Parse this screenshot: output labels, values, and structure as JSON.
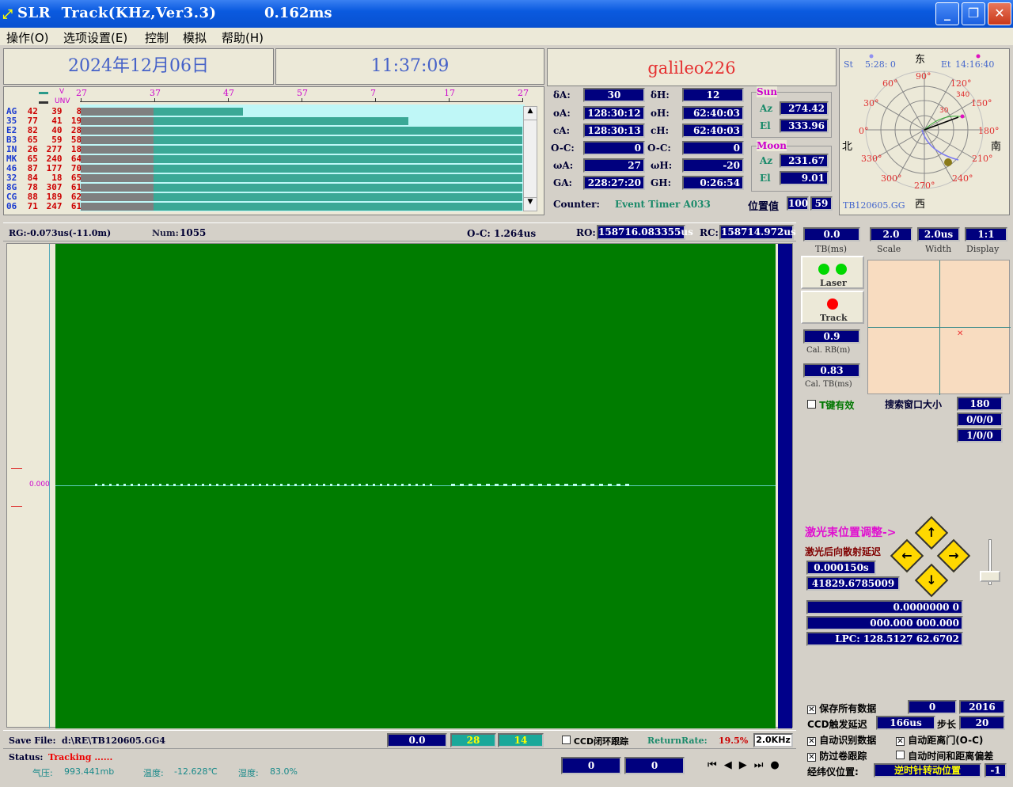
{
  "window": {
    "title": "SLR  Track(KHz,Ver3.3)",
    "timing": "0.162ms"
  },
  "menu": [
    "操作(O)",
    "选项设置(E)",
    "控制",
    "模拟",
    "帮助(H)"
  ],
  "header": {
    "date": "2024年12月06日",
    "time": "11:37:09",
    "satellite": "galileo226"
  },
  "sky_legend": {
    "v": "V",
    "unv": "UNV"
  },
  "sky_ticks": [
    "27",
    "37",
    "47",
    "57",
    "7",
    "17",
    "27"
  ],
  "sat_rows": [
    {
      "code": "AG",
      "a": "42",
      "b": "39",
      "c": "8",
      "fill": 0.367
    },
    {
      "code": "35",
      "a": "77",
      "b": "41",
      "c": "19",
      "fill": 0.742
    },
    {
      "code": "E2",
      "a": "82",
      "b": "40",
      "c": "28",
      "fill": 1
    },
    {
      "code": "B3",
      "a": "65",
      "b": "59",
      "c": "58",
      "fill": 1
    },
    {
      "code": "IN",
      "a": "26",
      "b": "277",
      "c": "18",
      "fill": 1
    },
    {
      "code": "MK",
      "a": "65",
      "b": "240",
      "c": "64",
      "fill": 1
    },
    {
      "code": "46",
      "a": "87",
      "b": "177",
      "c": "70",
      "fill": 1
    },
    {
      "code": "32",
      "a": "84",
      "b": "18",
      "c": "65",
      "fill": 1
    },
    {
      "code": "8G",
      "a": "78",
      "b": "307",
      "c": "61",
      "fill": 1
    },
    {
      "code": "CG",
      "a": "88",
      "b": "189",
      "c": "62",
      "fill": 1
    },
    {
      "code": "06",
      "a": "71",
      "b": "247",
      "c": "61",
      "fill": 1
    }
  ],
  "pos": {
    "dA_l": "δA:",
    "dA": "30",
    "dH_l": "δH:",
    "dH": "12",
    "oA_l": "oA:",
    "oA": "128:30:12",
    "oH_l": "oH:",
    "oH": "62:40:03",
    "cA_l": "cA:",
    "cA": "128:30:13",
    "cH_l": "cH:",
    "cH": "62:40:03",
    "ocA_l": "O-C:",
    "ocA": "0",
    "ocH_l": "O-C:",
    "ocH": "0",
    "wA_l": "ωA:",
    "wA": "27",
    "wH_l": "ωH:",
    "wH": "-20",
    "GA_l": "GA:",
    "GA": "228:27:20",
    "GH_l": "GH:",
    "GH": "0:26:54",
    "counter_l": "Counter:",
    "counter": "Event Timer A033",
    "posval_l": "位置值",
    "posval1": "100",
    "posval2": "59"
  },
  "sun": {
    "title": "Sun",
    "az_l": "Az",
    "az": "274.42",
    "el_l": "El",
    "el": "333.96"
  },
  "moon": {
    "title": "Moon",
    "az_l": "Az",
    "az": "231.67",
    "el_l": "El",
    "el": "9.01"
  },
  "polar": {
    "st": "St",
    "st_time": "5:28: 0",
    "et": "Et",
    "et_time": "14:16:40",
    "east": "东",
    "west": "西",
    "north": "北",
    "south": "南",
    "file": "TB120605.GG",
    "labels": [
      "90°",
      "120°",
      "150°",
      "180°",
      "210°",
      "240°",
      "270°",
      "300°",
      "330°",
      "0°",
      "30°",
      "60°",
      "340",
      "30"
    ]
  },
  "track": {
    "rg": "RG:-0.073us(-11.0m)",
    "num_l": "Num:",
    "num": "1055",
    "oc": "O-C: 1.264us",
    "ro_l": "RO:",
    "ro": "158716.083355us",
    "rc_l": "RC:",
    "rc": "158714.972us",
    "yaxis": "0.000"
  },
  "right": {
    "tb": "0.0",
    "tb_l": "TB(ms)",
    "scale": "2.0",
    "scale_l": "Scale",
    "width": "2.0us",
    "width_l": "Width",
    "display": "1:1",
    "display_l": "Display",
    "laser_l": "Laser",
    "track_l": "Track",
    "calrb": "0.9",
    "calrb_l": "Cal. RB(m)",
    "caltb": "0.83",
    "caltb_l": "Cal. TB(ms)",
    "tkey": "T键有效",
    "search_l": "搜索窗口大小",
    "search1": "180",
    "search2": "0/0/0",
    "search3": "1/0/0",
    "beam_l": "激光束位置调整->",
    "back_l": "激光后向散射延迟",
    "back1": "0.000150s",
    "back2": "41829.6785009",
    "v1": "0.0000000  0",
    "v2": "000.000 000.000",
    "lpc": "LPC: 128.5127   62.6702"
  },
  "bottom": {
    "save_l": "Save File:",
    "save": "d:\\RE\\TB120605.GG4",
    "b1": "0.0",
    "b2": "28",
    "b3": "14",
    "ccd": "CCD闭环跟踪",
    "rr_l": "ReturnRate:",
    "rr": "19.5%",
    "khz": "2.0KHz",
    "status_l": "Status:",
    "status": "Tracking ......",
    "pressure_l": "气压:",
    "pressure": "993.441mb",
    "temp_l": "温度:",
    "temp": "-12.628℃",
    "hum_l": "湿度:",
    "hum": "83.0%",
    "n1": "0",
    "n2": "0"
  },
  "opts": {
    "save_all": "保存所有数据",
    "sa1": "0",
    "sa2": "2016",
    "ccd_delay_l": "CCD触发延迟",
    "ccd_delay": "166us",
    "step_l": "步长",
    "step": "20",
    "auto_id": "自动识别数据",
    "auto_gate": "自动距离门(O-C)",
    "anti_cloud": "防过卷跟踪",
    "auto_time": "自动时间和距离偏差",
    "lon_l": "经纬仪位置:",
    "lon": "逆时针转动位置",
    "lon_v": "-1"
  }
}
